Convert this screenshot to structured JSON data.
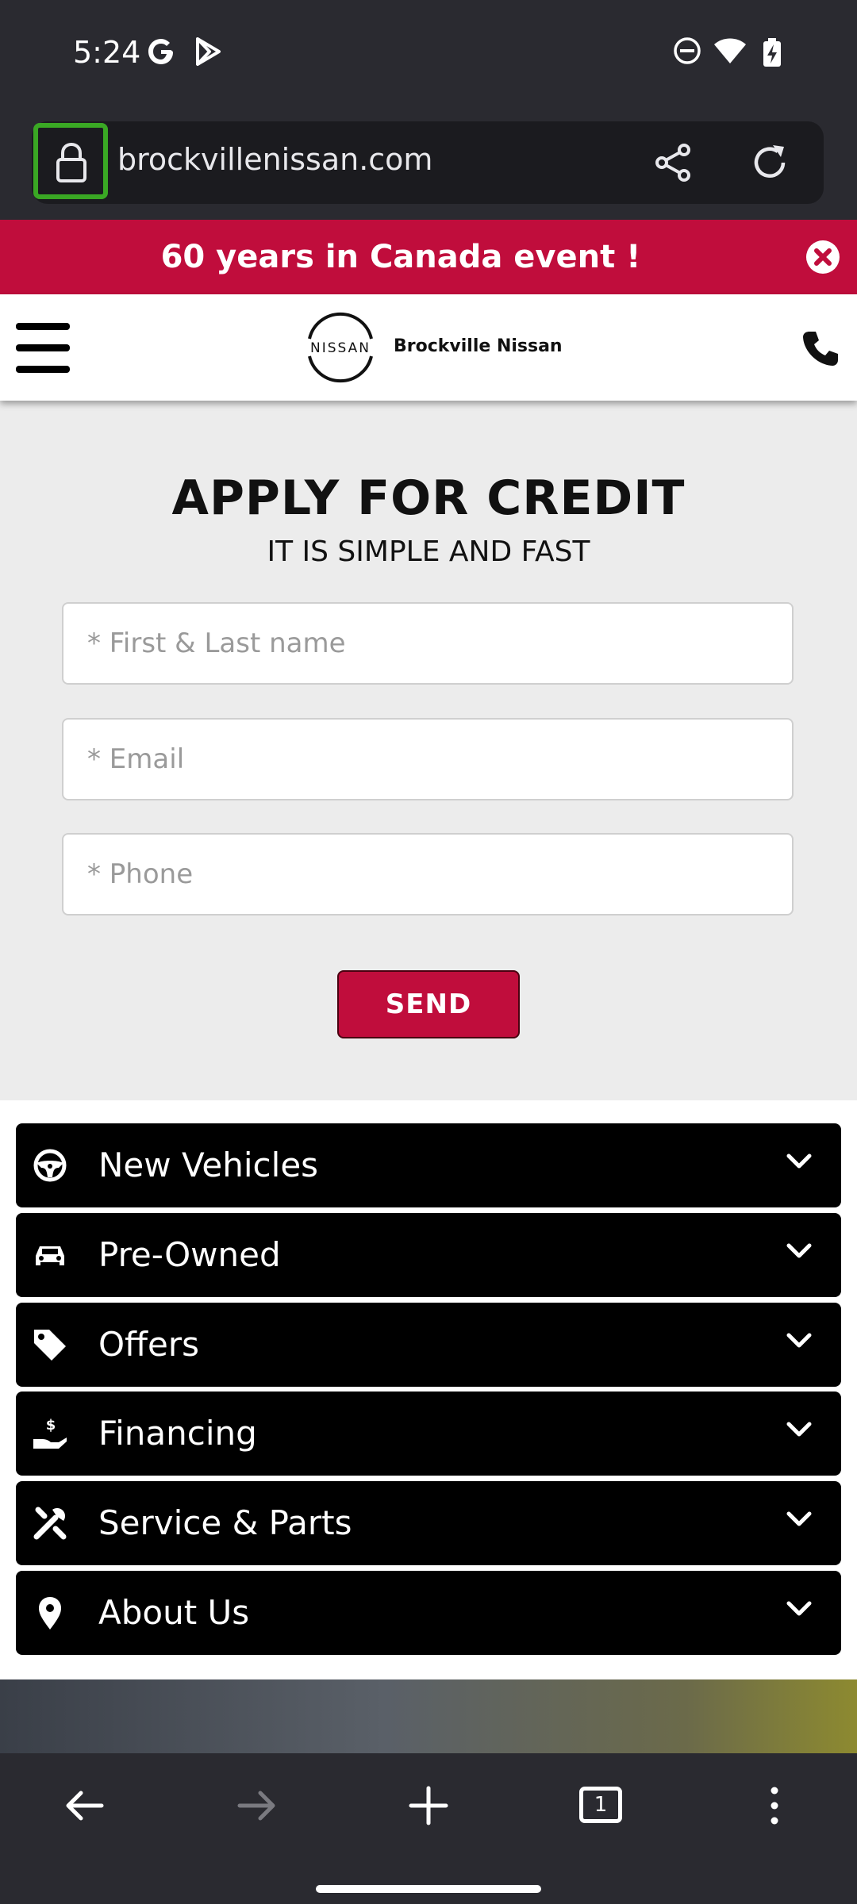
{
  "status_bar": {
    "time": "5:24"
  },
  "browser": {
    "url": "brockvillenissan.com",
    "tab_count": "1"
  },
  "banner": {
    "text": "60 years in Canada event !"
  },
  "header": {
    "brand": "Brockville Nissan",
    "logo_text": "NISSAN"
  },
  "form": {
    "title": "APPLY FOR CREDIT",
    "subtitle": "IT IS SIMPLE AND FAST",
    "name_placeholder": "* First & Last name",
    "email_placeholder": "* Email",
    "phone_placeholder": "* Phone",
    "send_label": "SEND"
  },
  "menu": {
    "items": [
      {
        "label": "New Vehicles",
        "icon": "steering-wheel-icon"
      },
      {
        "label": "Pre-Owned",
        "icon": "car-icon"
      },
      {
        "label": "Offers",
        "icon": "tag-icon"
      },
      {
        "label": "Financing",
        "icon": "hand-dollar-icon"
      },
      {
        "label": "Service & Parts",
        "icon": "tools-icon"
      },
      {
        "label": "About Us",
        "icon": "location-pin-icon"
      }
    ]
  },
  "colors": {
    "brand_red": "#c00d3c",
    "lock_highlight": "#3aa824"
  }
}
